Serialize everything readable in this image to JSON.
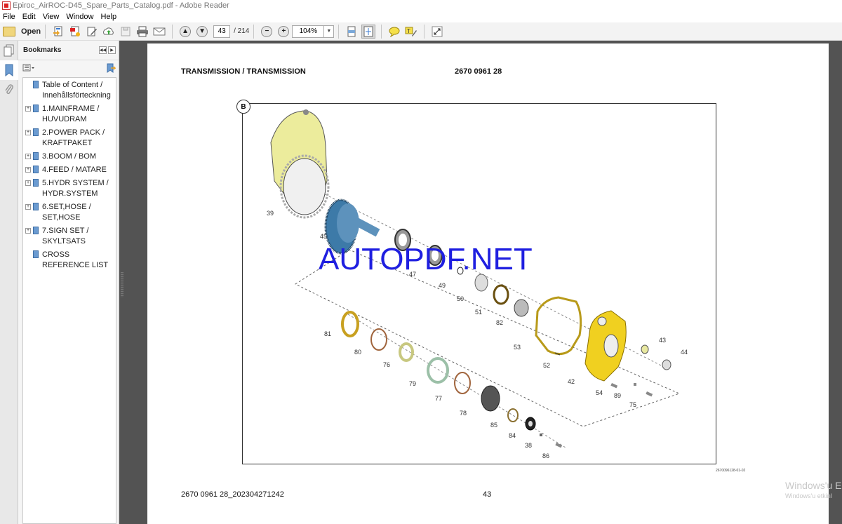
{
  "window": {
    "title": "Epiroc_AirROC-D45_Spare_Parts_Catalog.pdf - Adobe Reader"
  },
  "menu": [
    "File",
    "Edit",
    "View",
    "Window",
    "Help"
  ],
  "toolbar": {
    "open_label": "Open",
    "icons": [
      "create-pdf-icon",
      "export-pdf-icon",
      "edit-pdf-icon",
      "upload-cloud-icon",
      "save-icon",
      "print-icon",
      "email-icon",
      "prev-page-icon",
      "next-page-icon",
      "zoom-out-icon",
      "zoom-in-icon",
      "fit-page-icon",
      "fit-width-icon",
      "comment-icon",
      "highlight-icon",
      "fullscreen-icon"
    ],
    "current_page": "43",
    "total_pages": "/ 214",
    "zoom_level": "104%"
  },
  "bookmarks_panel": {
    "title": "Bookmarks",
    "items": [
      {
        "label": "Table of Content / Innehållsförteckning",
        "expandable": false
      },
      {
        "label": "1.MAINFRAME / HUVUDRAM",
        "expandable": true
      },
      {
        "label": "2.POWER PACK / KRAFTPAKET",
        "expandable": true
      },
      {
        "label": "3.BOOM / BOM",
        "expandable": true
      },
      {
        "label": "4.FEED / MATARE",
        "expandable": true
      },
      {
        "label": "5.HYDR SYSTEM / HYDR.SYSTEM",
        "expandable": true
      },
      {
        "label": "6.SET,HOSE / SET,HOSE",
        "expandable": true
      },
      {
        "label": "7.SIGN SET / SKYLTSATS",
        "expandable": true
      },
      {
        "label": "CROSS REFERENCE LIST",
        "expandable": false
      }
    ]
  },
  "document": {
    "title": "TRANSMISSION / TRANSMISSION",
    "part_number": "2670 0961 28",
    "figure_badge": "B",
    "figure_code": "2670096128-01-02",
    "watermark": "AUTOPDF.NET",
    "footer_doc_id": "2670 0961 28_202304271242",
    "footer_page": "43",
    "part_labels": [
      "39",
      "45",
      "47",
      "49",
      "50",
      "51",
      "82",
      "53",
      "52",
      "42",
      "43",
      "44",
      "54",
      "89",
      "75",
      "81",
      "80",
      "76",
      "79",
      "77",
      "78",
      "85",
      "84",
      "38",
      "86"
    ]
  },
  "os_overlay": {
    "line1": "Windows'u E",
    "line2": "Windows'u etkinl"
  }
}
